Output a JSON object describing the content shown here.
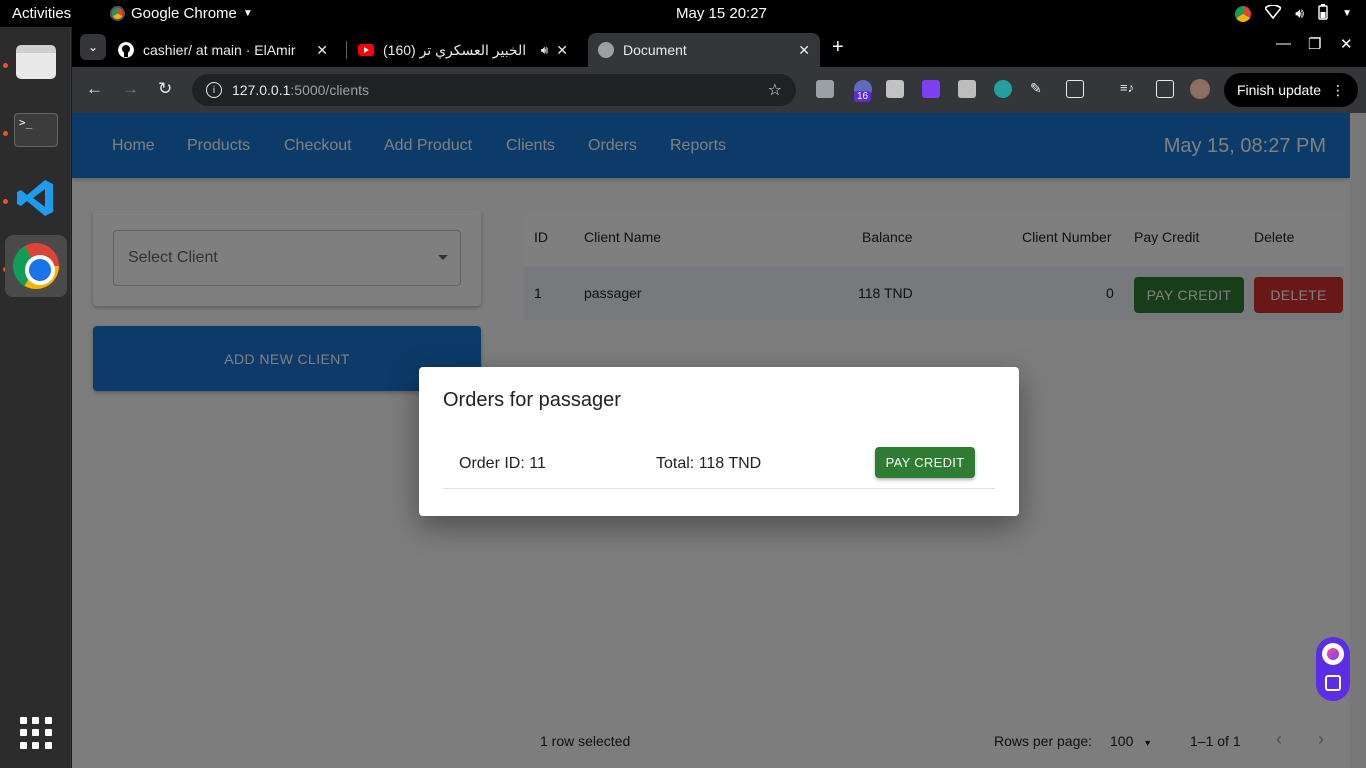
{
  "desktop": {
    "activities": "Activities",
    "app_name": "Google Chrome",
    "clock": "May 15  20:27"
  },
  "browser": {
    "tabs": [
      {
        "title": "cashier/ at main · ElAmir",
        "active": false,
        "icon": "github-icon"
      },
      {
        "title": "(160) الخبير العسكري تر",
        "active": false,
        "icon": "youtube-icon"
      },
      {
        "title": "Document",
        "active": true,
        "icon": "globe-icon"
      }
    ],
    "url_host": "127.0.0.1",
    "url_path": ":5000/clients",
    "extension_badge": "16",
    "finish_update": "Finish update"
  },
  "app": {
    "nav": [
      "Home",
      "Products",
      "Checkout",
      "Add Product",
      "Clients",
      "Orders",
      "Reports"
    ],
    "datetime": "May 15, 08:27 PM",
    "select_placeholder": "Select Client",
    "add_client": "ADD NEW CLIENT",
    "table": {
      "columns": [
        "ID",
        "Client Name",
        "Balance",
        "Client Number",
        "Pay Credit",
        "Delete"
      ],
      "rows": [
        {
          "id": "1",
          "name": "passager",
          "balance": "118 TND",
          "number": "0",
          "pay": "PAY CREDIT",
          "delete": "DELETE"
        }
      ],
      "footer": {
        "selected": "1 row selected",
        "rows_per_page_label": "Rows per page:",
        "rows_per_page": "100",
        "range": "1–1 of 1"
      }
    },
    "dialog": {
      "title": "Orders for passager",
      "order_id": "Order ID: 11",
      "total": "Total: 118 TND",
      "pay": "PAY CREDIT"
    }
  },
  "colors": {
    "appbar": "#1976d2",
    "pay_button": "#2e7d32",
    "delete_button": "#d32f2f"
  }
}
